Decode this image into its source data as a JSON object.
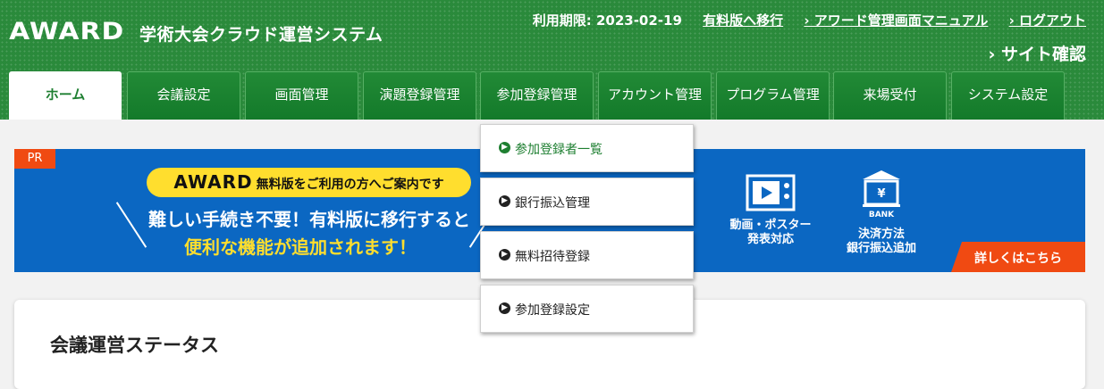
{
  "header": {
    "logo": "AWARD",
    "system_title": "学術大会クラウド運営システム",
    "expiry": "利用期限: 2023-02-19",
    "upgrade_link": "有料版へ移行",
    "manual_link": "› アワード管理画面マニュアル",
    "logout_link": "› ログアウト",
    "site_check": "› サイト確認"
  },
  "nav": {
    "tabs": [
      {
        "label": "ホーム",
        "active": true
      },
      {
        "label": "会議設定"
      },
      {
        "label": "画面管理"
      },
      {
        "label": "演題登録管理"
      },
      {
        "label": "参加登録管理"
      },
      {
        "label": "アカウント管理"
      },
      {
        "label": "プログラム管理"
      },
      {
        "label": "来場受付"
      },
      {
        "label": "システム設定"
      }
    ]
  },
  "banner": {
    "pr": "PR",
    "pill_logo": "AWARD",
    "pill_text": "無料版をご利用の方へご案内です",
    "line1": "難しい手続き不要！有料版に移行すると",
    "line2": "便利な機能が追加されます！",
    "features": [
      {
        "line1": "動画・ポスター",
        "line2": "発表対応",
        "icon": "video-icon"
      },
      {
        "line1": "決済方法",
        "line2": "銀行振込追加",
        "icon": "bank-icon",
        "badge": "BANK"
      }
    ],
    "more": "詳しくはこちら"
  },
  "dropdown": {
    "items": [
      {
        "label": "参加登録者一覧",
        "active": true
      },
      {
        "label": "銀行振込管理"
      },
      {
        "label": "無料招待登録"
      },
      {
        "label": "参加登録設定"
      }
    ]
  },
  "status_card": {
    "title": "会議運営ステータス"
  },
  "colors": {
    "header_green": "#2a8a3b",
    "banner_blue": "#0b67c2",
    "accent_orange": "#f04a12",
    "pill_yellow": "#ffde2e"
  }
}
